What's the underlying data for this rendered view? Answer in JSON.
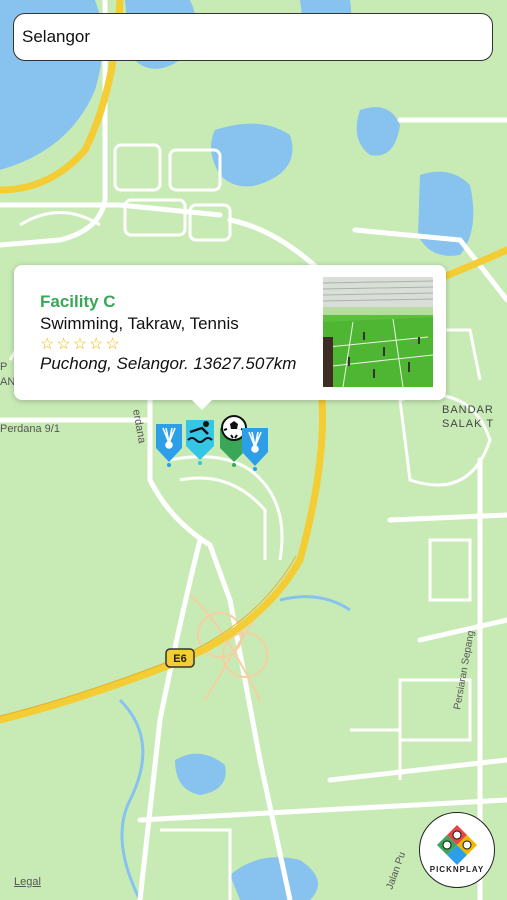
{
  "search": {
    "value": "Selangor"
  },
  "popup": {
    "name": "Facility C",
    "sports": "Swimming, Takraw, Tennis",
    "rating_stars": "☆☆☆☆☆",
    "rating": 0,
    "location": "Puchong, Selangor. 13627.507km"
  },
  "map_labels": {
    "road_perdana": "Perdana 9/1",
    "road_perdana_v": "erdana",
    "bandar_1": "BANDAR",
    "bandar_2": "SALAK T",
    "highway": "E6",
    "persiaran": "Persiaran Sepang",
    "jalan": "Jalan Pu",
    "left_p": "P",
    "left_an": "AN"
  },
  "markers": [
    {
      "sport": "badminton",
      "color": "#2d9ee8"
    },
    {
      "sport": "swimming",
      "color": "#35c6e6"
    },
    {
      "sport": "football",
      "color": "#3aa657"
    },
    {
      "sport": "badminton",
      "color": "#2d9ee8"
    }
  ],
  "colors": {
    "land": "#c8ebb6",
    "water": "#87c3ee",
    "highway": "#f4cc33",
    "road": "#ffffff",
    "accent": "#3aa657",
    "star": "#f1b700"
  },
  "legal": "Legal",
  "logo": {
    "text": "PICKNPLAY"
  }
}
